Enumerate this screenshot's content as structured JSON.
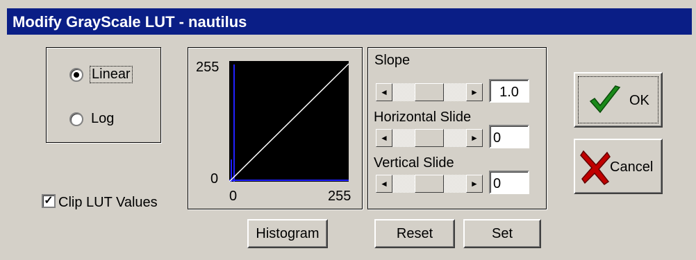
{
  "window": {
    "title": "Modify GrayScale LUT - nautilus"
  },
  "mode": {
    "options": [
      "Linear",
      "Log"
    ],
    "selected": "Linear"
  },
  "clip": {
    "label": "Clip LUT Values",
    "checked": true
  },
  "graph": {
    "y_max": "255",
    "y_min": "0",
    "x_min": "0",
    "x_max": "255"
  },
  "controls": {
    "slope": {
      "label": "Slope",
      "value": "1.0"
    },
    "horizontal": {
      "label": "Horizontal Slide",
      "value": "0"
    },
    "vertical": {
      "label": "Vertical Slide",
      "value": "0"
    }
  },
  "buttons": {
    "histogram": "Histogram",
    "reset": "Reset",
    "set": "Set",
    "ok": "OK",
    "cancel": "Cancel"
  },
  "icons": {
    "scroll_left": "◄",
    "scroll_right": "►",
    "ok_icon": "checkmark-icon",
    "cancel_icon": "x-mark-icon"
  },
  "colors": {
    "titlebar": "#0a1e86",
    "ok_check": "#1a8a1a",
    "cancel_x": "#c00000",
    "histogram": "#2020ff"
  }
}
